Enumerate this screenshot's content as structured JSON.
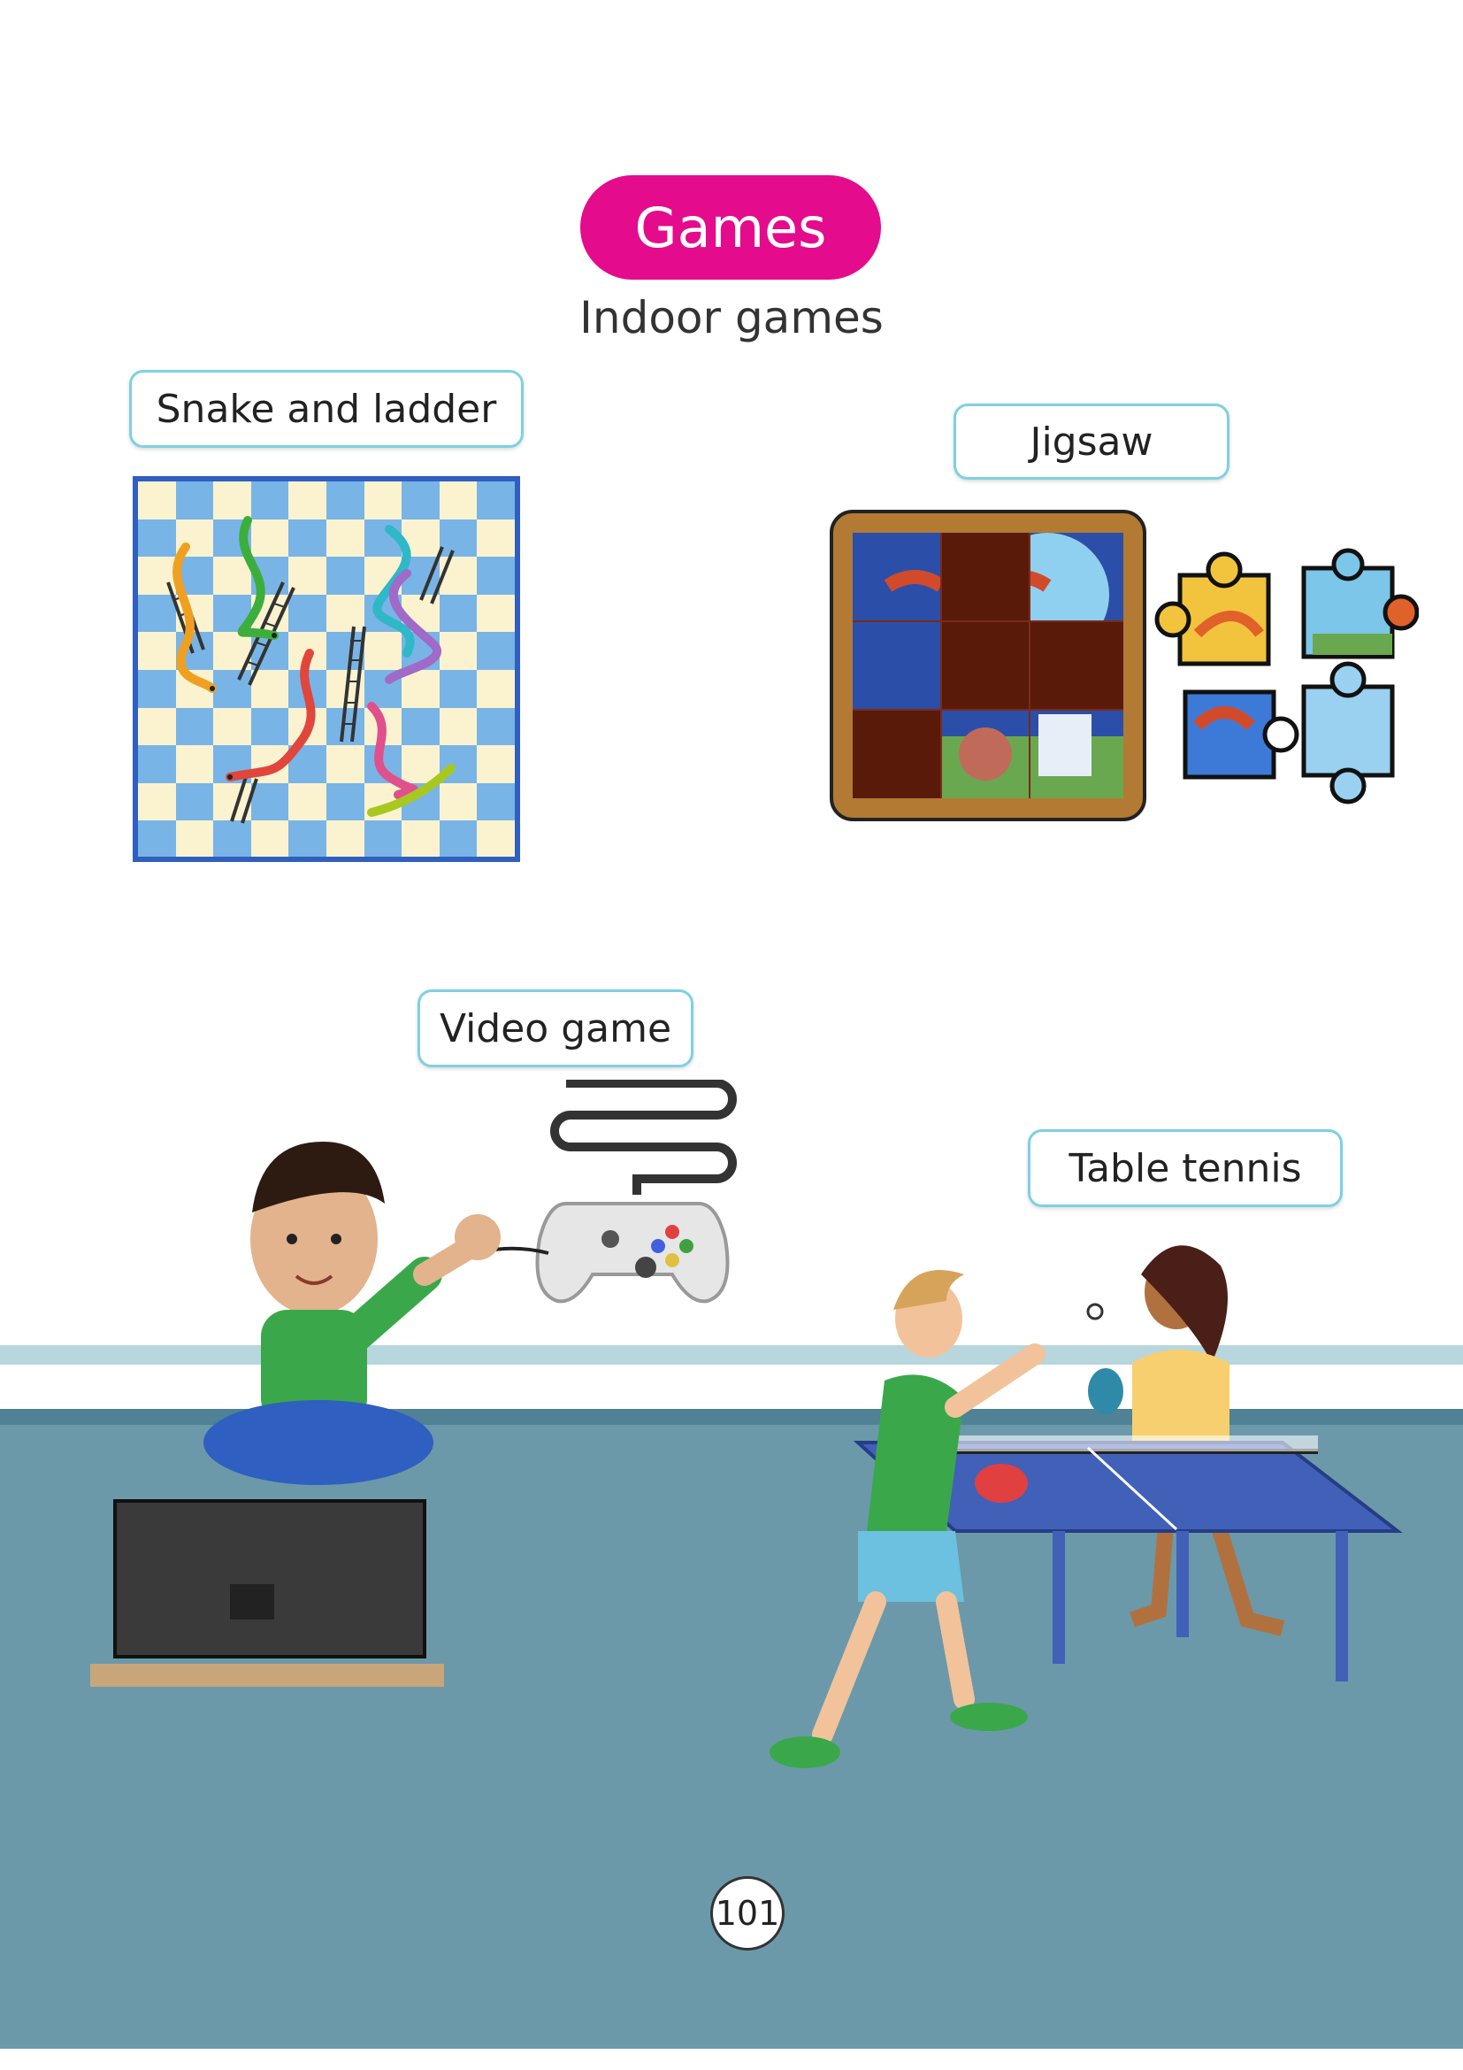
{
  "page": {
    "title": "Games",
    "subtitle": "Indoor games",
    "page_number": "101"
  },
  "labels": {
    "snake_and_ladder": "Snake and ladder",
    "jigsaw": "Jigsaw",
    "video_game": "Video game",
    "table_tennis": "Table tennis"
  },
  "colors": {
    "title_pill": "#e40b8c",
    "label_border": "#7fd0e3",
    "floor": "#6b99aa",
    "board_blue": "#79b4e6",
    "board_cream": "#fbf3cf"
  }
}
